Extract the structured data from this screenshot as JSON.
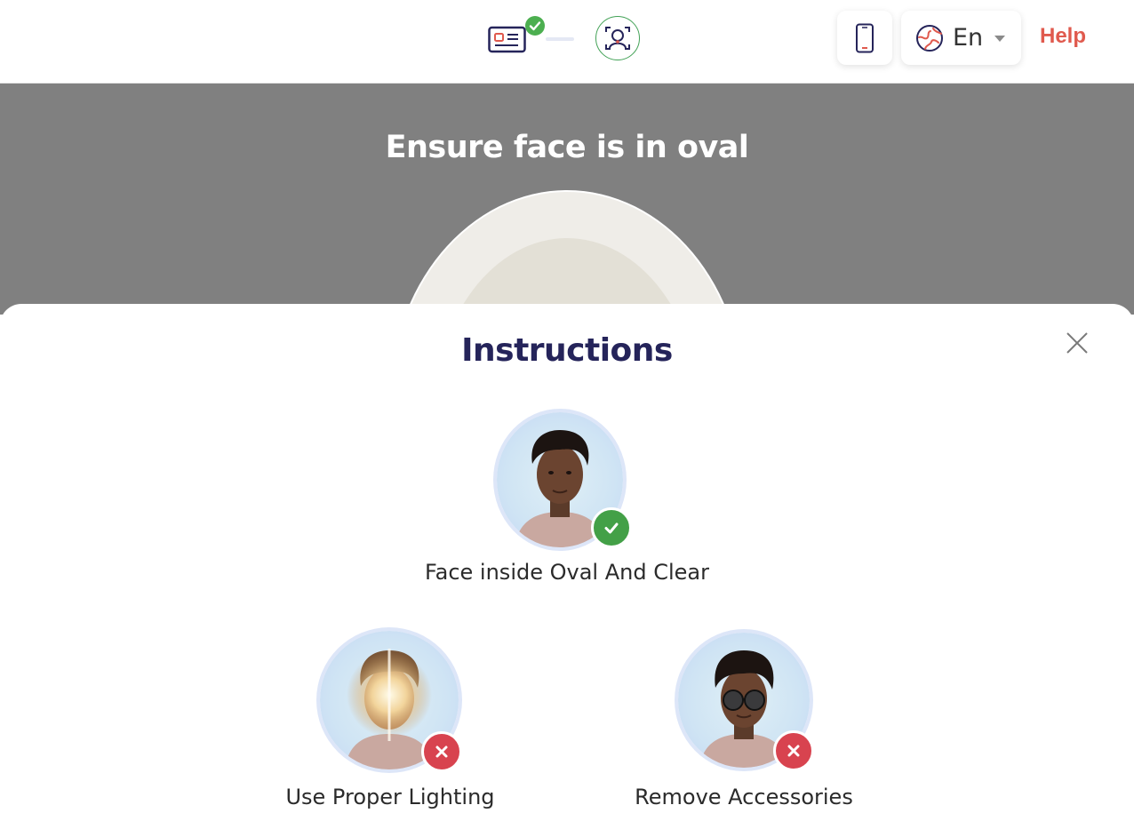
{
  "header": {
    "steps": [
      {
        "name": "id-card-step",
        "status": "complete"
      },
      {
        "name": "face-scan-step",
        "status": "active"
      }
    ],
    "language": {
      "value": "En"
    },
    "help_label": "Help"
  },
  "stage": {
    "title": "Ensure face is in oval"
  },
  "instructions": {
    "title": "Instructions",
    "tips": [
      {
        "label": "Face inside Oval And Clear",
        "status": "correct"
      },
      {
        "label": "Use Proper Lighting",
        "status": "incorrect"
      },
      {
        "label": "Remove Accessories",
        "status": "incorrect"
      }
    ]
  },
  "colors": {
    "accent_red": "#e05a4e",
    "success_green": "#43a047",
    "error_red": "#d8434f",
    "title_navy": "#25245a",
    "stage_gray": "#808080"
  }
}
